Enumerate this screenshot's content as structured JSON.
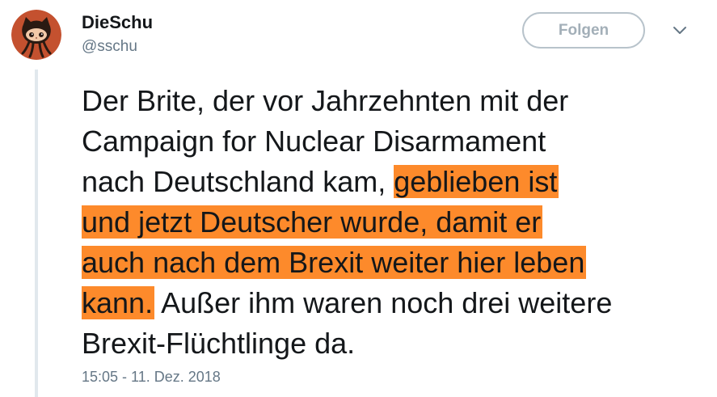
{
  "tweet": {
    "author": {
      "display_name": "DieSchu",
      "handle": "@sschu",
      "avatar_icon": "octocat-avatar-icon"
    },
    "follow_button_label": "Folgen",
    "menu_icon": "chevron-down-icon",
    "lines": [
      {
        "plain_before": "Der Brite, der vor Jahrzehnten mit der",
        "highlight": "",
        "plain_after": ""
      },
      {
        "plain_before": "Campaign for Nuclear Disarmament",
        "highlight": "",
        "plain_after": ""
      },
      {
        "plain_before": "nach Deutschland kam, ",
        "highlight": "geblieben ist",
        "plain_after": ""
      },
      {
        "plain_before": "",
        "highlight": "und jetzt Deutscher wurde, damit er",
        "plain_after": ""
      },
      {
        "plain_before": "",
        "highlight": "auch nach dem Brexit weiter hier leben",
        "plain_after": ""
      },
      {
        "plain_before": "",
        "highlight": "kann.",
        "plain_after": " Außer ihm waren noch drei weitere"
      },
      {
        "plain_before": "Brexit-Flüchtlinge da.",
        "highlight": "",
        "plain_after": ""
      }
    ],
    "highlight_color": "#fd8a2b",
    "timestamp": "15:05 - 11. Dez. 2018"
  }
}
